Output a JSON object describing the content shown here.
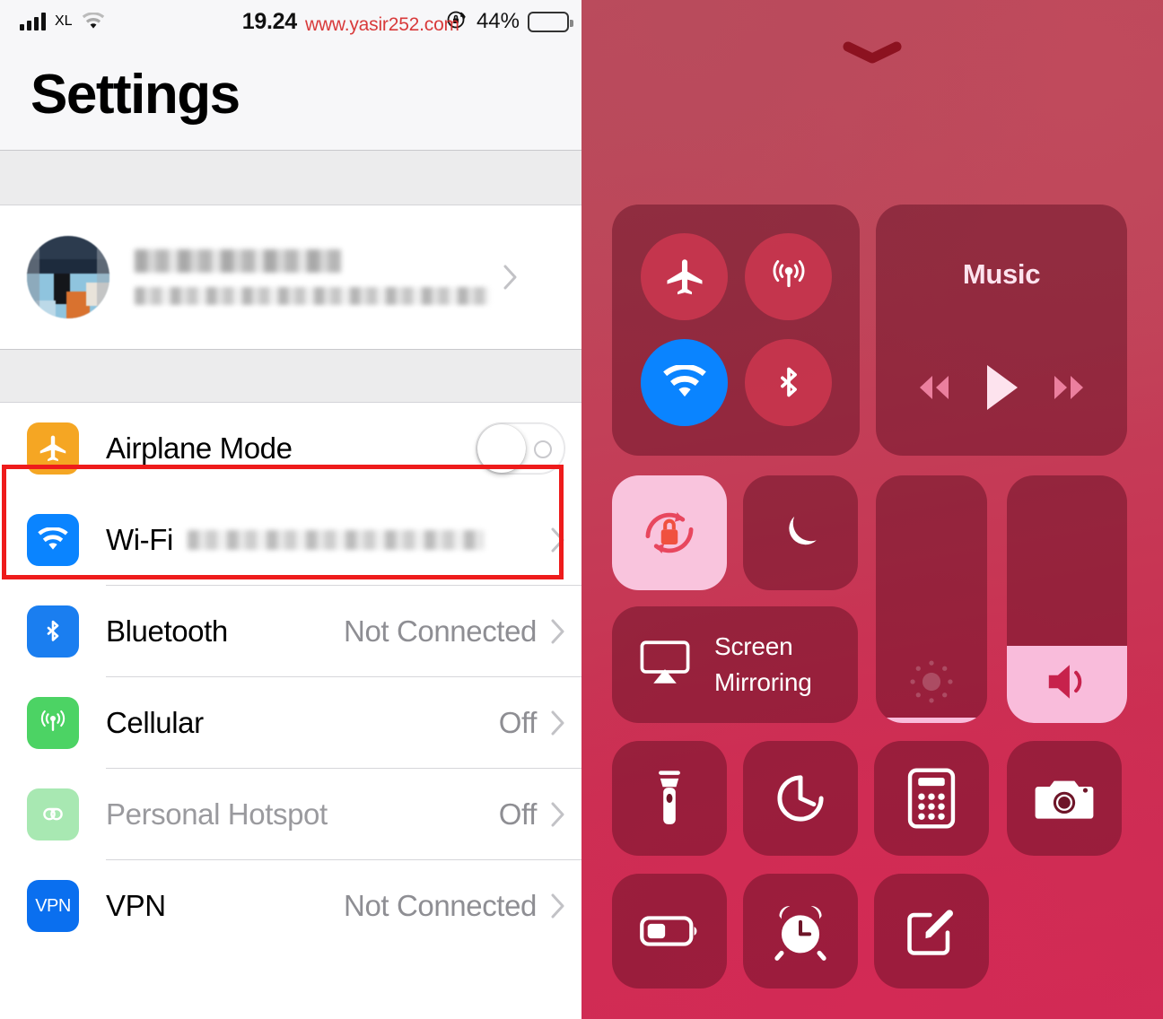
{
  "statusbar": {
    "signal_icon": "signal-bars-icon",
    "carrier": "XL",
    "wifi_icon": "wifi-icon",
    "time": "19.24",
    "watermark": "www.yasir252.com",
    "rotation_lock_icon": "rotation-lock-icon",
    "battery_percent": "44%",
    "battery_icon": "battery-icon",
    "battery_level": 44
  },
  "settings": {
    "title": "Settings",
    "profile": {
      "avatar_icon": "avatar",
      "name": "",
      "subtitle": "",
      "chevron_icon": "chevron-right-icon"
    },
    "rows": [
      {
        "id": "airplane-mode",
        "label": "Airplane Mode",
        "icon": "airplane-icon",
        "icon_color": "#f5a623",
        "control": "toggle",
        "toggle_on": false,
        "value": ""
      },
      {
        "id": "wifi",
        "label": "Wi-Fi",
        "icon": "wifi-icon",
        "icon_color": "#0a84ff",
        "control": "chevron",
        "value": ""
      },
      {
        "id": "bluetooth",
        "label": "Bluetooth",
        "icon": "bluetooth-icon",
        "icon_color": "#1a7ef0",
        "control": "chevron",
        "value": "Not Connected"
      },
      {
        "id": "cellular",
        "label": "Cellular",
        "icon": "cellular-icon",
        "icon_color": "#4cd364",
        "control": "chevron",
        "value": "Off"
      },
      {
        "id": "personal-hotspot",
        "label": "Personal Hotspot",
        "icon": "hotspot-icon",
        "icon_color": "#a8e8b2",
        "control": "chevron",
        "value": "Off",
        "disabled": true
      },
      {
        "id": "vpn",
        "label": "VPN",
        "icon": "vpn-icon",
        "icon_color": "#0a6fef",
        "icon_text": "VPN",
        "control": "chevron",
        "value": "Not Connected"
      }
    ],
    "highlight_color": "#ee1b1b"
  },
  "control_center": {
    "handle_icon": "chevron-down-handle-icon",
    "connectivity": {
      "airplane": {
        "icon": "airplane-icon",
        "label": "Airplane Mode",
        "active": false
      },
      "cellular": {
        "icon": "cellular-icon",
        "label": "Cellular Data",
        "active": false
      },
      "wifi": {
        "icon": "wifi-icon",
        "label": "Wi-Fi",
        "active": true
      },
      "bluetooth": {
        "icon": "bluetooth-icon",
        "label": "Bluetooth",
        "active": false
      }
    },
    "music": {
      "title": "Music",
      "rewind_icon": "rewind-icon",
      "play_icon": "play-icon",
      "forward_icon": "fast-forward-icon"
    },
    "rotation_lock": {
      "icon": "rotation-lock-icon",
      "label": "Rotation Lock",
      "active": true
    },
    "do_not_disturb": {
      "icon": "moon-icon",
      "label": "Do Not Disturb",
      "active": false
    },
    "screen_mirroring": {
      "icon": "airplay-icon",
      "line1": "Screen",
      "line2": "Mirroring"
    },
    "brightness": {
      "icon": "brightness-icon",
      "label": "Brightness",
      "level": 2
    },
    "volume": {
      "icon": "volume-icon",
      "label": "Volume",
      "level": 31
    },
    "apps": [
      {
        "id": "flashlight",
        "icon": "flashlight-icon",
        "label": "Flashlight"
      },
      {
        "id": "timer",
        "icon": "timer-icon",
        "label": "Timer"
      },
      {
        "id": "calculator",
        "icon": "calculator-icon",
        "label": "Calculator"
      },
      {
        "id": "camera",
        "icon": "camera-icon",
        "label": "Camera"
      },
      {
        "id": "low-power",
        "icon": "battery-icon",
        "label": "Low Power Mode"
      },
      {
        "id": "alarm",
        "icon": "alarm-clock-icon",
        "label": "Alarm"
      },
      {
        "id": "notes",
        "icon": "notes-icon",
        "label": "Notes"
      }
    ],
    "highlight_color": "#ee1b1b"
  }
}
